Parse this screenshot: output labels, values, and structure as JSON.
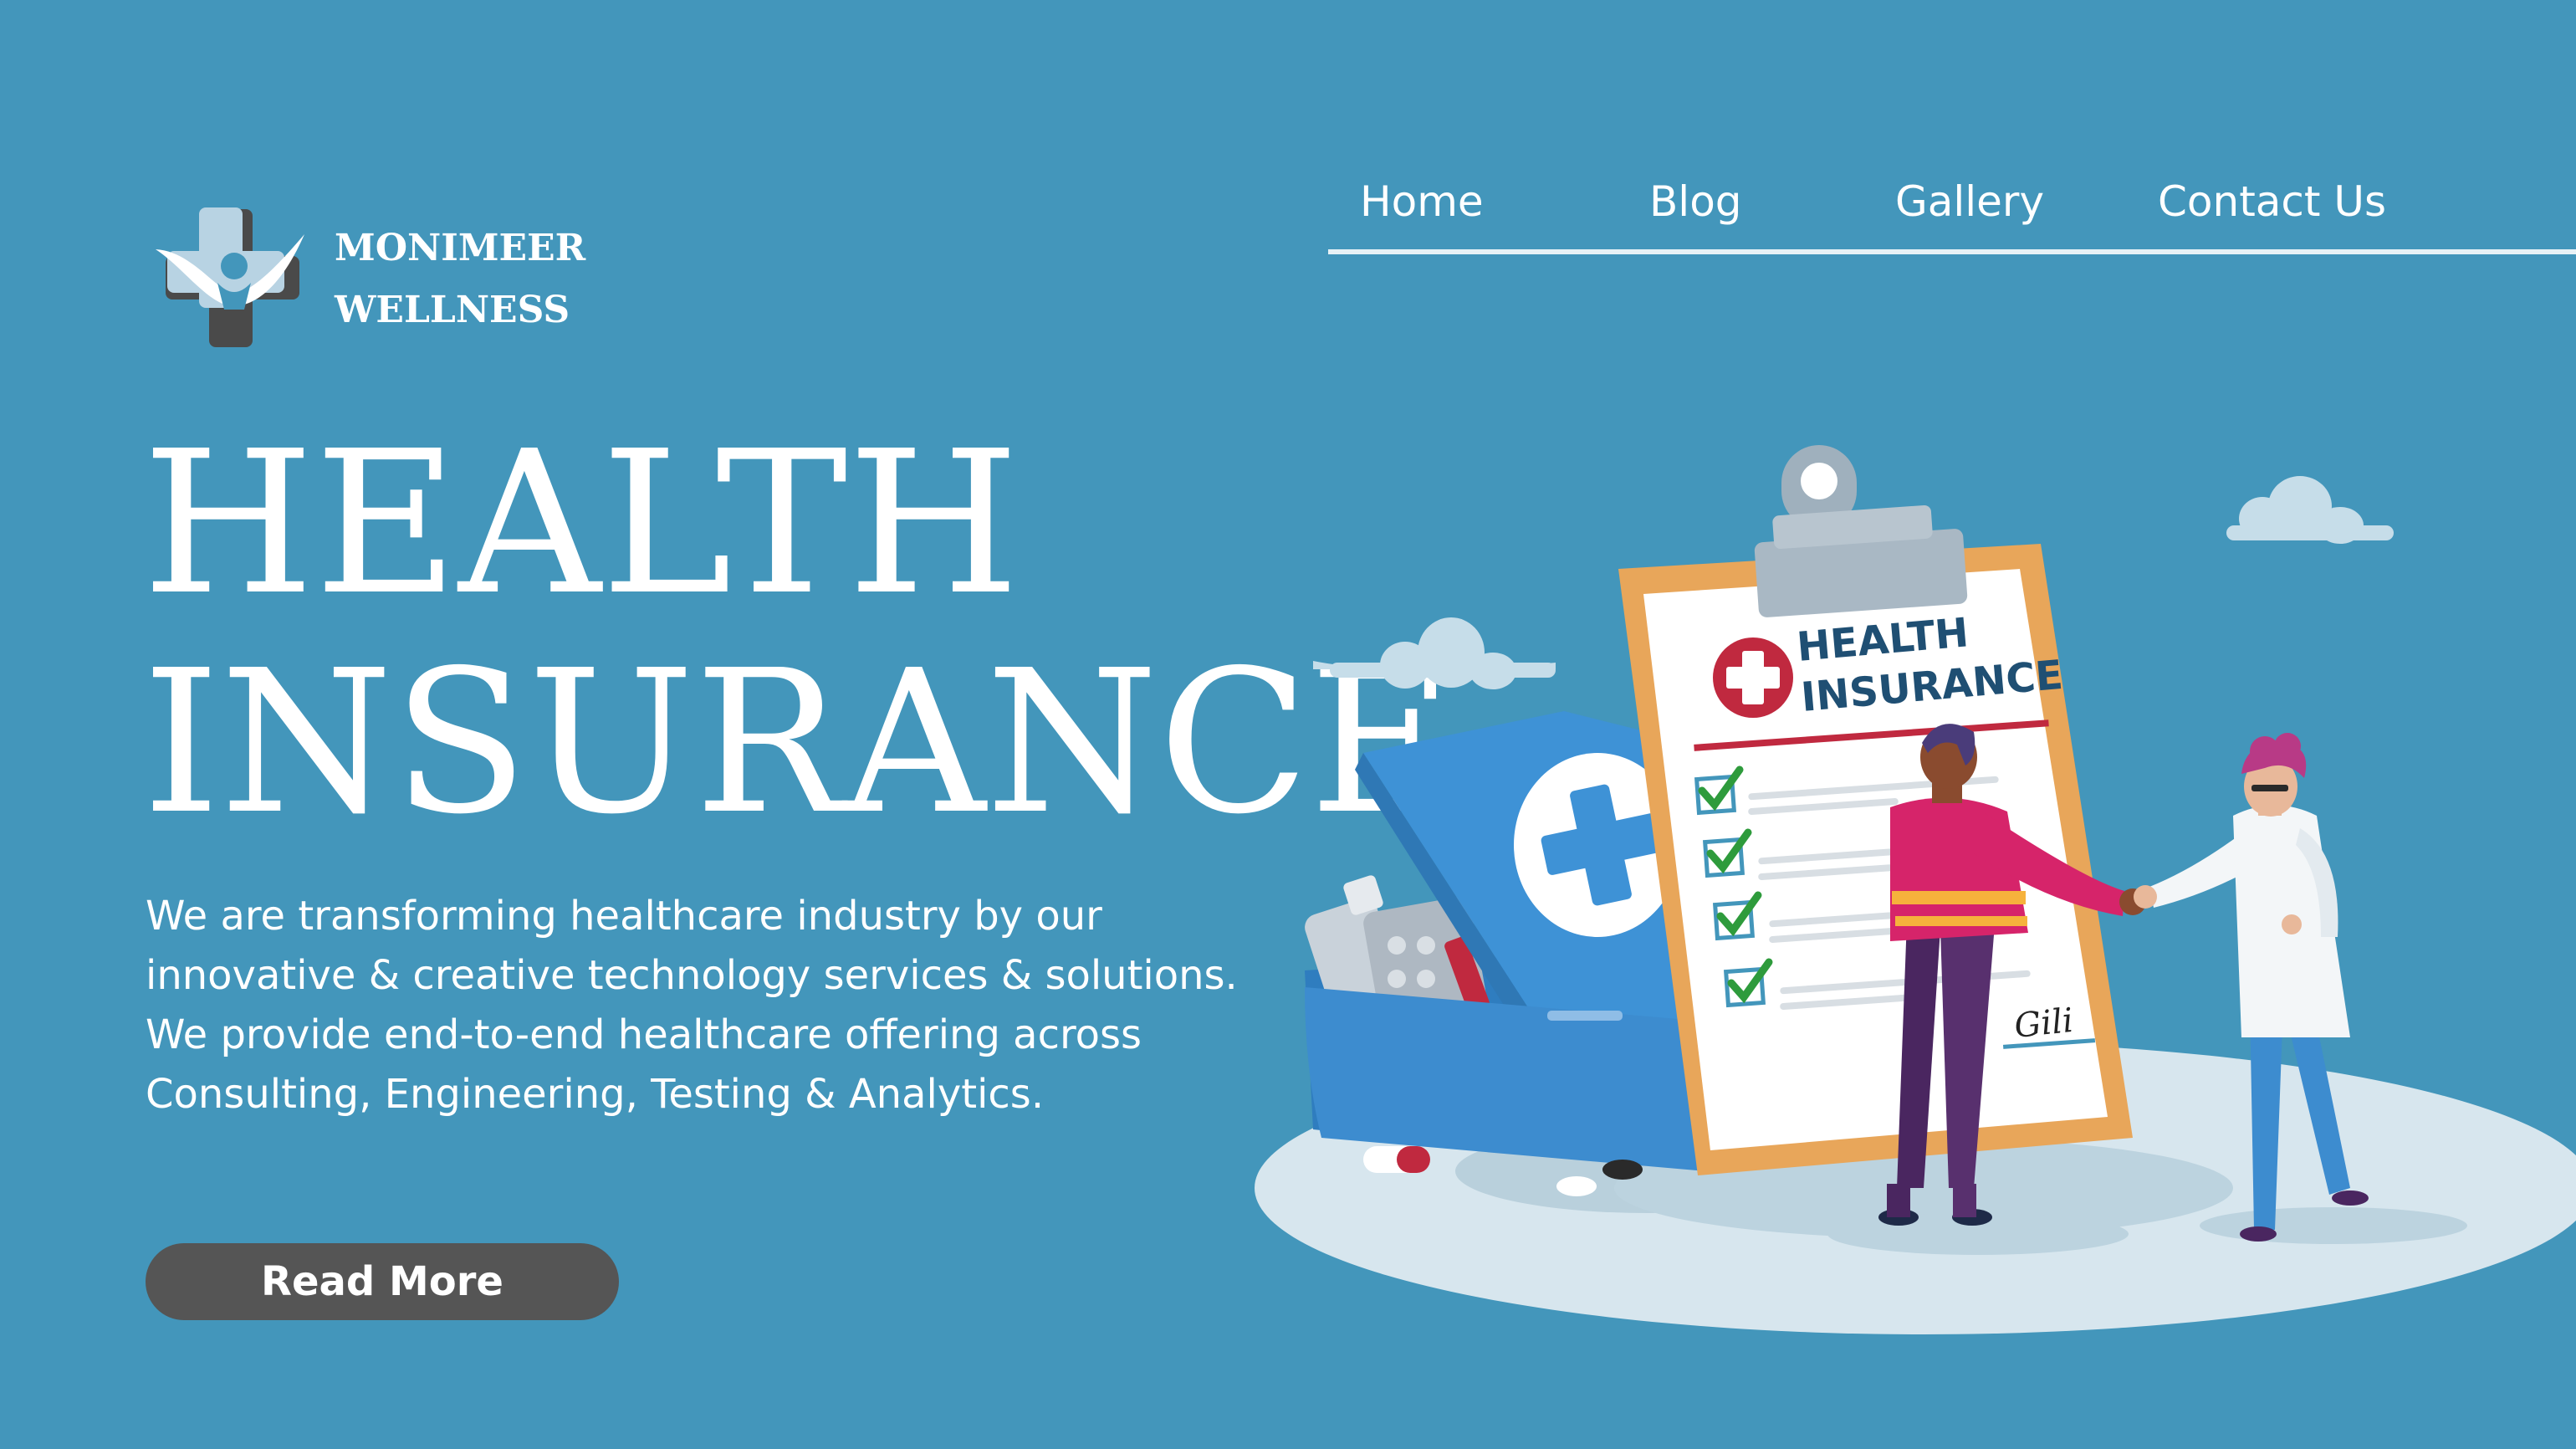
{
  "brand": {
    "line1": "MONIMEER",
    "line2": "WELLNESS"
  },
  "nav": {
    "items": [
      {
        "label": "Home"
      },
      {
        "label": "Blog"
      },
      {
        "label": "Gallery"
      },
      {
        "label": "Contact Us"
      }
    ]
  },
  "hero": {
    "title_line1": "HEALTH",
    "title_line2": "INSURANCE",
    "description": "We are transforming healthcare industry by our innovative & creative technology services & solutions. We provide end-to-end healthcare offering across Consulting, Engineering, Testing & Analytics.",
    "button_label": "Read More"
  },
  "illustration": {
    "clipboard_title_line1": "HEALTH",
    "clipboard_title_line2": "INSURANCE",
    "signature": "Gili"
  },
  "colors": {
    "background": "#4396bb",
    "button": "#555555",
    "text": "#ffffff",
    "clipboard_frame": "#e8a65a",
    "clipboard_title": "#1f4f73",
    "clipboard_underline": "#c0293f",
    "check": "#2e9b3c",
    "first_aid_box": "#3d8ccf"
  },
  "icons": {
    "logo": "medical-cross-person-icon",
    "first_aid": "plus-icon"
  }
}
